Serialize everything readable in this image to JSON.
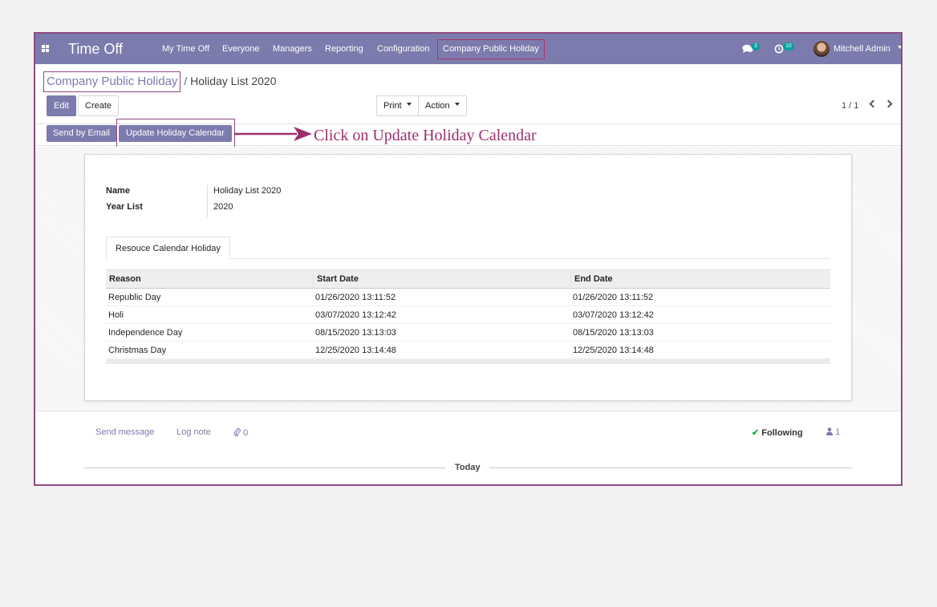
{
  "navbar": {
    "app_title": "Time Off",
    "menu": [
      "My Time Off",
      "Everyone",
      "Managers",
      "Reporting",
      "Configuration",
      "Company Public Holiday"
    ],
    "messages_count": "3",
    "activities_count": "10",
    "user_name": "Mitchell Admin",
    "color": "#7c7bad"
  },
  "breadcrumb": {
    "parent": "Company Public Holiday",
    "separator": "/",
    "current": "Holiday List 2020"
  },
  "buttons": {
    "edit": "Edit",
    "create": "Create",
    "print": "Print",
    "action": "Action"
  },
  "pager": {
    "value": "1 / 1"
  },
  "statusbar": {
    "send_email": "Send by Email",
    "update_calendar": "Update Holiday Calendar"
  },
  "annotation": {
    "text": "Click on Update Holiday Calendar",
    "color": "#9c2f6e"
  },
  "form": {
    "fields": [
      {
        "label": "Name",
        "value": "Holiday List 2020"
      },
      {
        "label": "Year List",
        "value": "2020"
      }
    ],
    "tab_label": "Resouce Calendar Holiday",
    "table": {
      "columns": [
        "Reason",
        "Start Date",
        "End Date"
      ],
      "rows": [
        [
          "Republic Day",
          "01/26/2020 13:11:52",
          "01/26/2020 13:11:52"
        ],
        [
          "Holi",
          "03/07/2020 13:12:42",
          "03/07/2020 13:12:42"
        ],
        [
          "Independence Day",
          "08/15/2020 13:13:03",
          "08/15/2020 13:13:03"
        ],
        [
          "Christmas Day",
          "12/25/2020 13:14:48",
          "12/25/2020 13:14:48"
        ]
      ]
    }
  },
  "chatter": {
    "send_message": "Send message",
    "log_note": "Log note",
    "attachments": "0",
    "following": "Following",
    "followers": "1",
    "today": "Today"
  }
}
